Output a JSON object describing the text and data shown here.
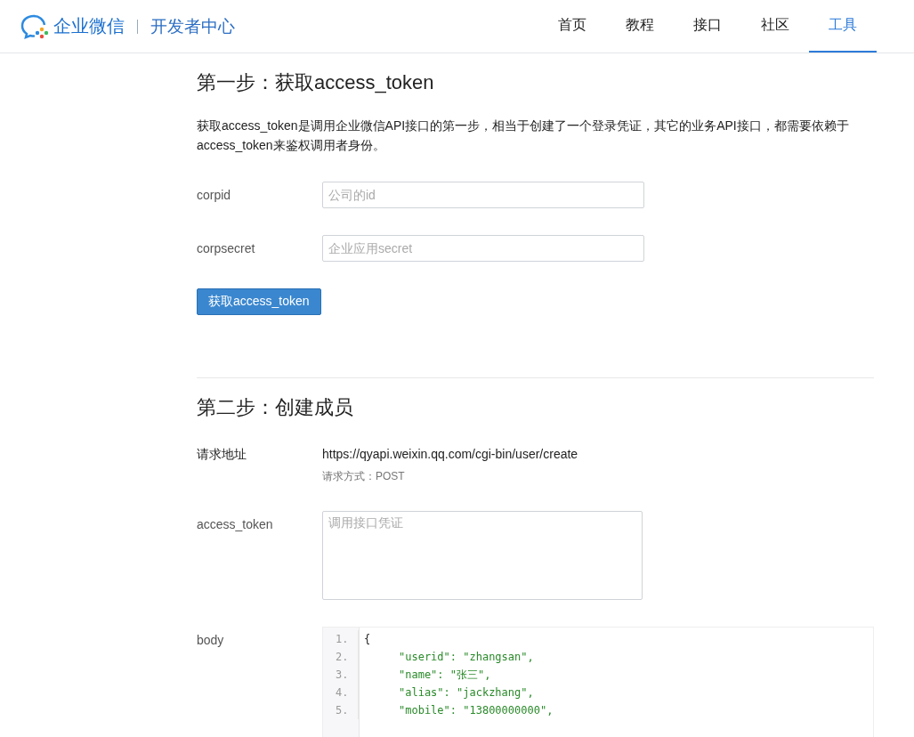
{
  "header": {
    "brand": "企业微信",
    "section": "开发者中心",
    "nav": [
      {
        "label": "首页",
        "selected": false
      },
      {
        "label": "教程",
        "selected": false
      },
      {
        "label": "接口",
        "selected": false
      },
      {
        "label": "社区",
        "selected": false
      },
      {
        "label": "工具",
        "selected": true
      }
    ]
  },
  "step1": {
    "title": "第一步：获取access_token",
    "description": "获取access_token是调用企业微信API接口的第一步，相当于创建了一个登录凭证，其它的业务API接口，都需要依赖于access_token来鉴权调用者身份。",
    "fields": [
      {
        "label": "corpid",
        "placeholder": "公司的id"
      },
      {
        "label": "corpsecret",
        "placeholder": "企业应用secret"
      }
    ],
    "button": "获取access_token"
  },
  "step2": {
    "title": "第二步：创建成员",
    "url_label": "请求地址",
    "url": "https://qyapi.weixin.qq.com/cgi-bin/user/create",
    "method": "请求方式：POST",
    "token_label": "access_token",
    "token_placeholder": "调用接口凭证",
    "body_label": "body",
    "code": [
      {
        "number": "1.",
        "kind": "brace",
        "text": "{"
      },
      {
        "number": "2.",
        "kind": "entry",
        "text": "\"userid\": \"zhangsan\","
      },
      {
        "number": "3.",
        "kind": "entry",
        "text": "\"name\": \"张三\","
      },
      {
        "number": "4.",
        "kind": "entry",
        "text": "\"alias\": \"jackzhang\","
      },
      {
        "number": "5.",
        "kind": "entry",
        "text": "\"mobile\": \"13800000000\","
      }
    ]
  }
}
